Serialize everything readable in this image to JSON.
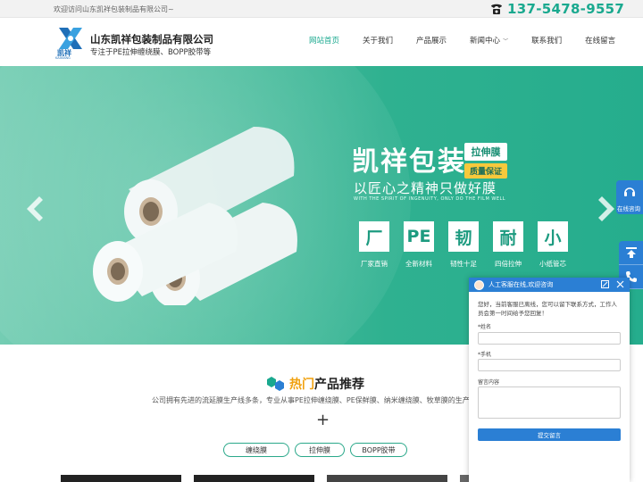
{
  "topbar": {
    "welcome": "欢迎访问山东凯祥包装制品有限公司~",
    "phone": "137-5478-9557"
  },
  "header": {
    "logo_text": "凯祥",
    "logo_en": "KAIXIANG",
    "company_name": "山东凯祥包装制品有限公司",
    "slogan": "专注于PE拉伸缠绕膜、BOPP胶带等"
  },
  "nav": {
    "items": [
      {
        "label": "网站首页"
      },
      {
        "label": "关于我们"
      },
      {
        "label": "产品展示"
      },
      {
        "label": "新闻中心"
      },
      {
        "label": "联系我们"
      },
      {
        "label": "在线留言"
      }
    ]
  },
  "banner": {
    "headline": "凯祥包装",
    "tag_top": "拉伸膜",
    "tag_bottom": "质量保证",
    "subline": "以匠心之精神只做好膜",
    "en_line": "WITH THE SPIRIT OF INGENUITY, ONLY DO THE FILM WELL",
    "features": [
      {
        "char": "厂",
        "caption": "厂家直销"
      },
      {
        "char": "PE",
        "caption": "全新材料"
      },
      {
        "char": "韧",
        "caption": "韧性十足"
      },
      {
        "char": "耐",
        "caption": "四倍拉伸"
      },
      {
        "char": "小",
        "caption": "小纸管芯"
      }
    ],
    "accent": "#2fb190"
  },
  "side": {
    "online_label": "在线咨询"
  },
  "products": {
    "title_highlight": "热门",
    "title_rest": "产品推荐",
    "description": "公司拥有先进的流延膜生产线多条，专业从事PE拉伸缠绕膜、PE保鲜膜、纳米缠绕膜、牧草膜的生产",
    "plus": "+",
    "tabs": [
      {
        "label": "缠绕膜"
      },
      {
        "label": "拉伸膜"
      },
      {
        "label": "BOPP胶带"
      }
    ]
  },
  "chat": {
    "title": "人工客服在线,欢迎咨询",
    "message": "您好，当前客服已离线，您可以留下联系方式，工作人员会第一时间给予您回复！",
    "name_label": "*姓名",
    "phone_label": "*手机",
    "message_label": "留言内容",
    "submit_label": "提交留言",
    "accent": "#2b7fd4"
  }
}
